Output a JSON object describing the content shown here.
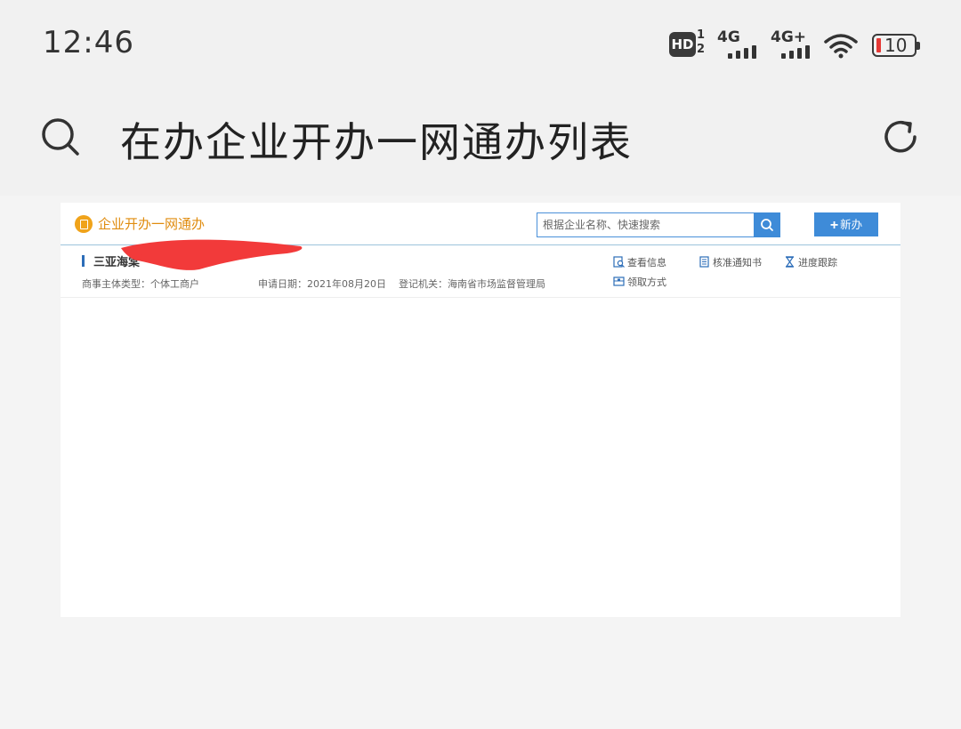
{
  "status_bar": {
    "time": "12:46",
    "hd_label": "HD",
    "hd_sub_top": "1",
    "hd_sub_bottom": "2",
    "sim1_network": "4G",
    "sim2_network": "4G+",
    "battery_level": "10"
  },
  "header": {
    "title": "在办企业开办一网通办列表"
  },
  "web": {
    "brand": "企业开办一网通办",
    "search_placeholder": "根据企业名称、快速搜索",
    "new_button": "新办",
    "record": {
      "name": "三亚海棠",
      "entity_type": "商事主体类型：个体工商户",
      "apply_date": "申请日期：2021年08月20日",
      "authority": "登记机关：海南省市场监督管理局",
      "actions": {
        "view_info": "查看信息",
        "approval_notice": "核准通知书",
        "progress": "进度跟踪",
        "pickup": "领取方式"
      }
    }
  },
  "colors": {
    "accent_blue": "#3e8bd8",
    "brand_orange": "#e08c0f",
    "redaction_red": "#f23a3a",
    "battery_low": "#e53935"
  }
}
